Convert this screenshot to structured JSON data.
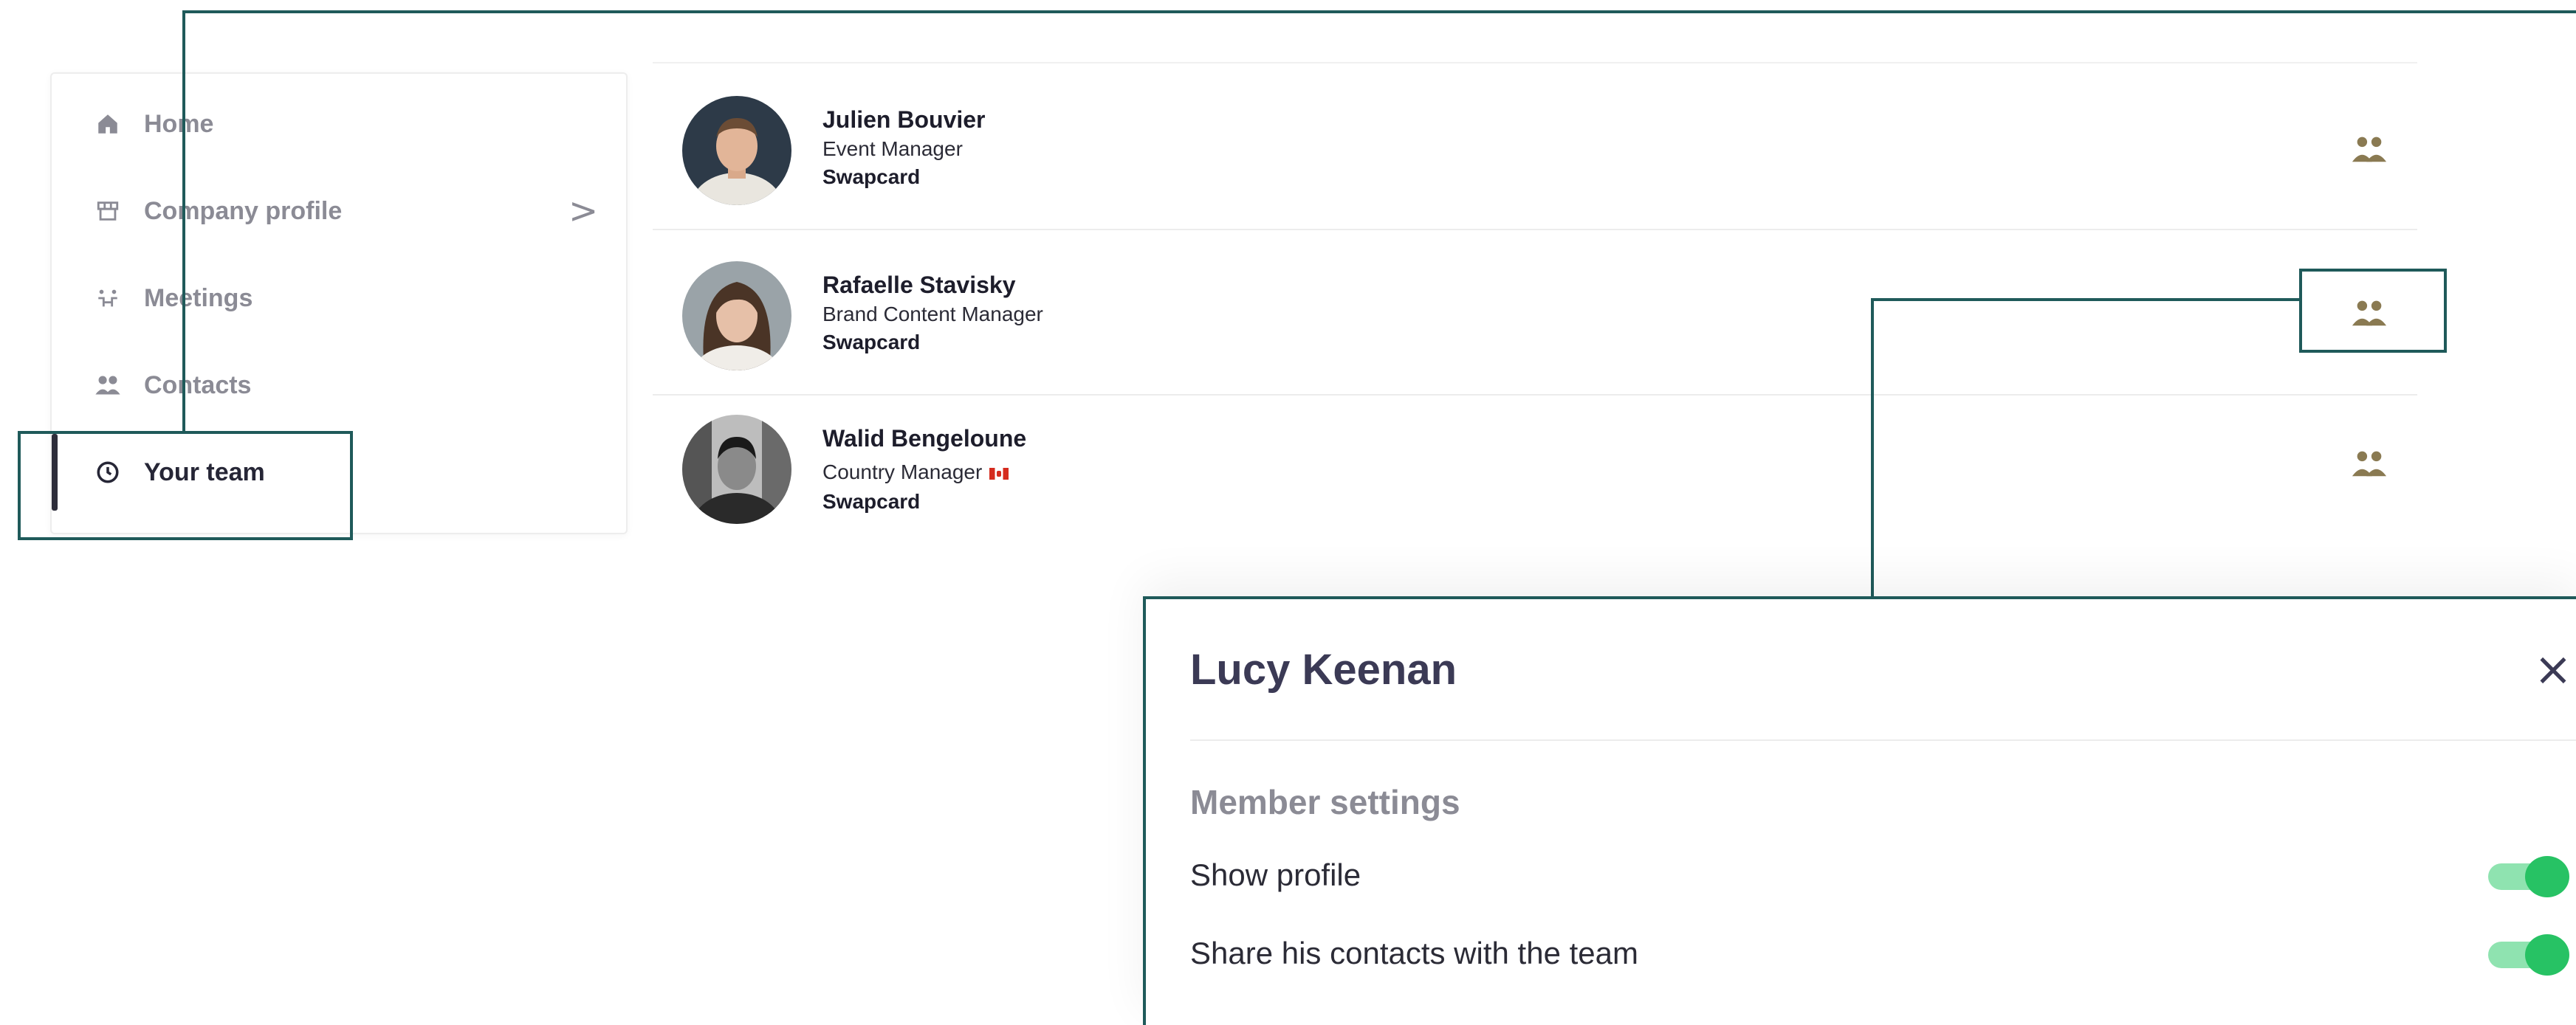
{
  "sidebar": {
    "items": [
      {
        "label": "Home",
        "icon": "home-icon"
      },
      {
        "label": "Company profile",
        "icon": "storefront-icon",
        "chevron": ">"
      },
      {
        "label": "Meetings",
        "icon": "meetings-icon"
      },
      {
        "label": "Contacts",
        "icon": "contacts-icon"
      },
      {
        "label": "Your team",
        "icon": "team-clock-icon",
        "active": true
      }
    ]
  },
  "team": {
    "members": [
      {
        "name": "Julien Bouvier",
        "title": "Event Manager",
        "company": "Swapcard"
      },
      {
        "name": "Rafaelle Stavisky",
        "title": "Brand Content Manager",
        "company": "Swapcard"
      },
      {
        "name": "Walid Bengeloune",
        "title": "Country Manager",
        "company": "Swapcard",
        "flag": "canada-flag"
      }
    ]
  },
  "panel": {
    "title": "Lucy Keenan",
    "close": "×",
    "section": "Member settings",
    "settings": [
      {
        "label": "Show profile",
        "enabled": true
      },
      {
        "label": "Share his contacts with the team",
        "enabled": true
      }
    ]
  },
  "colors": {
    "annotation": "#1f5a5a",
    "toggle_on": "#27c264",
    "toggle_track": "#8fe3b0",
    "muted_text": "#8b8b95"
  }
}
